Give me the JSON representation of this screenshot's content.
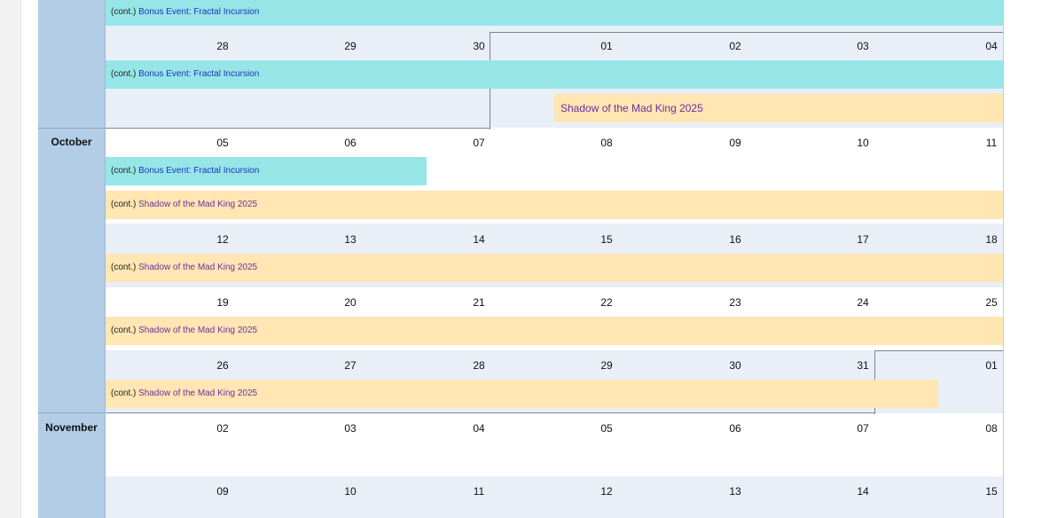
{
  "calendar": {
    "months": {
      "october": "October",
      "november": "November"
    },
    "cont_prefix": "(cont.)",
    "events": {
      "fractal": "Bonus Event: Fractal Incursion",
      "mad_king": "Shadow of the Mad King 2025"
    },
    "weeks": [
      {
        "days": [
          "28",
          "29",
          "30",
          "01",
          "02",
          "03",
          "04"
        ]
      },
      {
        "days": [
          "05",
          "06",
          "07",
          "08",
          "09",
          "10",
          "11"
        ]
      },
      {
        "days": [
          "12",
          "13",
          "14",
          "15",
          "16",
          "17",
          "18"
        ]
      },
      {
        "days": [
          "19",
          "20",
          "21",
          "22",
          "23",
          "24",
          "25"
        ]
      },
      {
        "days": [
          "26",
          "27",
          "28",
          "29",
          "30",
          "31",
          "01"
        ]
      },
      {
        "days": [
          "02",
          "03",
          "04",
          "05",
          "06",
          "07",
          "08"
        ]
      },
      {
        "days": [
          "09",
          "10",
          "11",
          "12",
          "13",
          "14",
          "15"
        ]
      }
    ],
    "colors": {
      "month_column": "#b3cde7",
      "week_alt": "#e8eff7",
      "fractal_bar": "#96e6e8",
      "fractal_text": "#1a35b8",
      "mad_king_bar": "#ffe6b3",
      "mad_king_text": "#6d2f9a"
    }
  }
}
